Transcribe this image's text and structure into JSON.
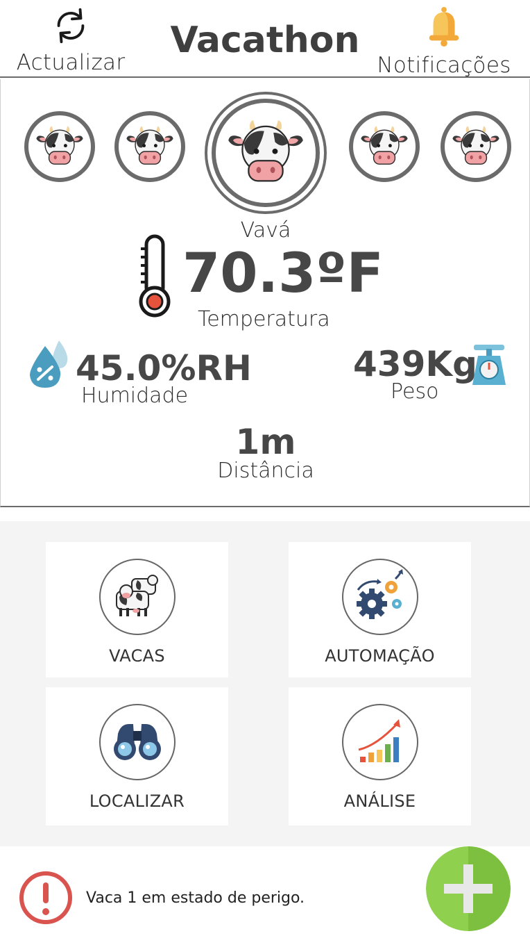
{
  "header": {
    "title": "Vacathon",
    "refresh_label": "Actualizar",
    "notifications_label": "Notificações"
  },
  "selected_cow": {
    "name": "Vavá",
    "temperature": "70.3ºF",
    "temperature_label": "Temperatura",
    "humidity": "45.0%RH",
    "humidity_label": "Humidade",
    "weight": "439Kg",
    "weight_label": "Peso",
    "distance": "1m",
    "distance_label": "Distância"
  },
  "menu": {
    "cows": "VACAS",
    "automation": "AUTOMAÇÃO",
    "locate": "LOCALIZAR",
    "analysis": "ANÁLISE"
  },
  "footer": {
    "alert_text": "Vaca 1 em estado de perigo."
  },
  "colors": {
    "accent_green": "#8fd14f",
    "alert_red": "#d9534f",
    "border_gray": "#6b6b6b"
  },
  "icons": [
    "refresh-icon",
    "bell-icon",
    "cow-icon",
    "thermometer-icon",
    "humidity-icon",
    "scale-icon",
    "herd-icon",
    "gears-icon",
    "binoculars-icon",
    "growth-chart-icon",
    "alert-icon",
    "plus-icon"
  ]
}
